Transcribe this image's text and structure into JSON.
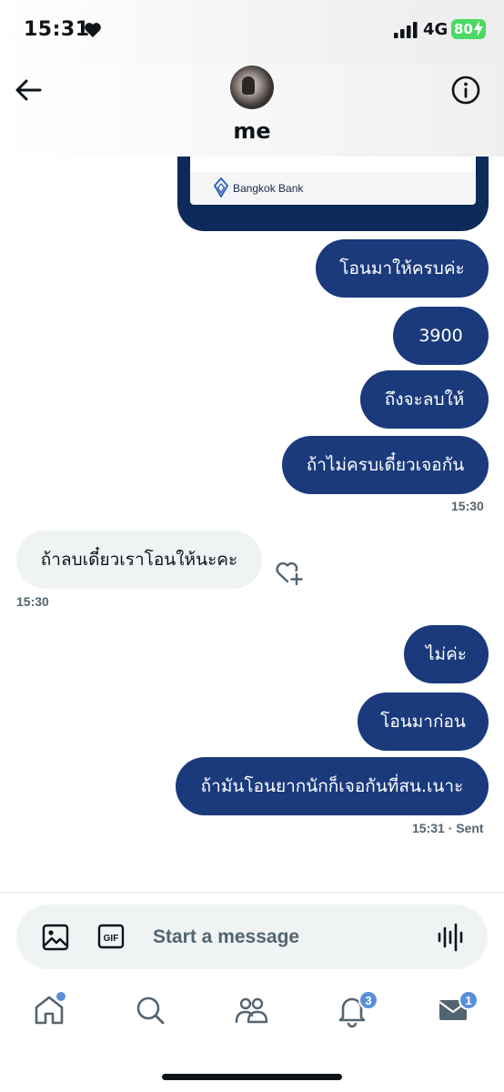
{
  "status_bar": {
    "time": "15:31",
    "network": "4G",
    "battery": "80"
  },
  "header": {
    "contact_name": "me",
    "icons": {
      "back": "arrow-left-icon",
      "info": "info-icon"
    }
  },
  "chat": {
    "image_attachment": {
      "bank_name": "Bangkok Bank"
    },
    "messages": [
      {
        "direction": "out",
        "text": "โอนมาให้ครบค่ะ"
      },
      {
        "direction": "out",
        "text": "3900"
      },
      {
        "direction": "out",
        "text": "ถึงจะลบให้"
      },
      {
        "direction": "out",
        "text": "ถ้าไม่ครบเดี๋ยวเจอกัน",
        "time": "15:30"
      },
      {
        "direction": "in",
        "text": "ถ้าลบเดี๋ยวเราโอนให้นะคะ",
        "time": "15:30"
      },
      {
        "direction": "out",
        "text": "ไม่ค่ะ"
      },
      {
        "direction": "out",
        "text": "โอนมาก่อน"
      },
      {
        "direction": "out",
        "text": "ถ้ามันโอนยากนักก็เจอกันที่สน.เนาะ",
        "time": "15:31 · Sent"
      }
    ]
  },
  "composer": {
    "placeholder": "Start a message",
    "icons": [
      "image-icon",
      "gif-icon",
      "voice-wave-icon"
    ]
  },
  "nav": {
    "items": [
      {
        "name": "home",
        "icon": "home-icon",
        "badge": ""
      },
      {
        "name": "search",
        "icon": "search-icon",
        "badge": ""
      },
      {
        "name": "communities",
        "icon": "people-icon",
        "badge": ""
      },
      {
        "name": "notifications",
        "icon": "bell-icon",
        "badge": "3"
      },
      {
        "name": "messages",
        "icon": "envelope-icon",
        "badge": "1"
      }
    ]
  },
  "colors": {
    "outgoing_bubble": "#1a3a7c",
    "incoming_bubble": "#eff3f4",
    "timestamp": "#536471",
    "badge": "#5a8fd8",
    "battery": "#4cd964"
  }
}
